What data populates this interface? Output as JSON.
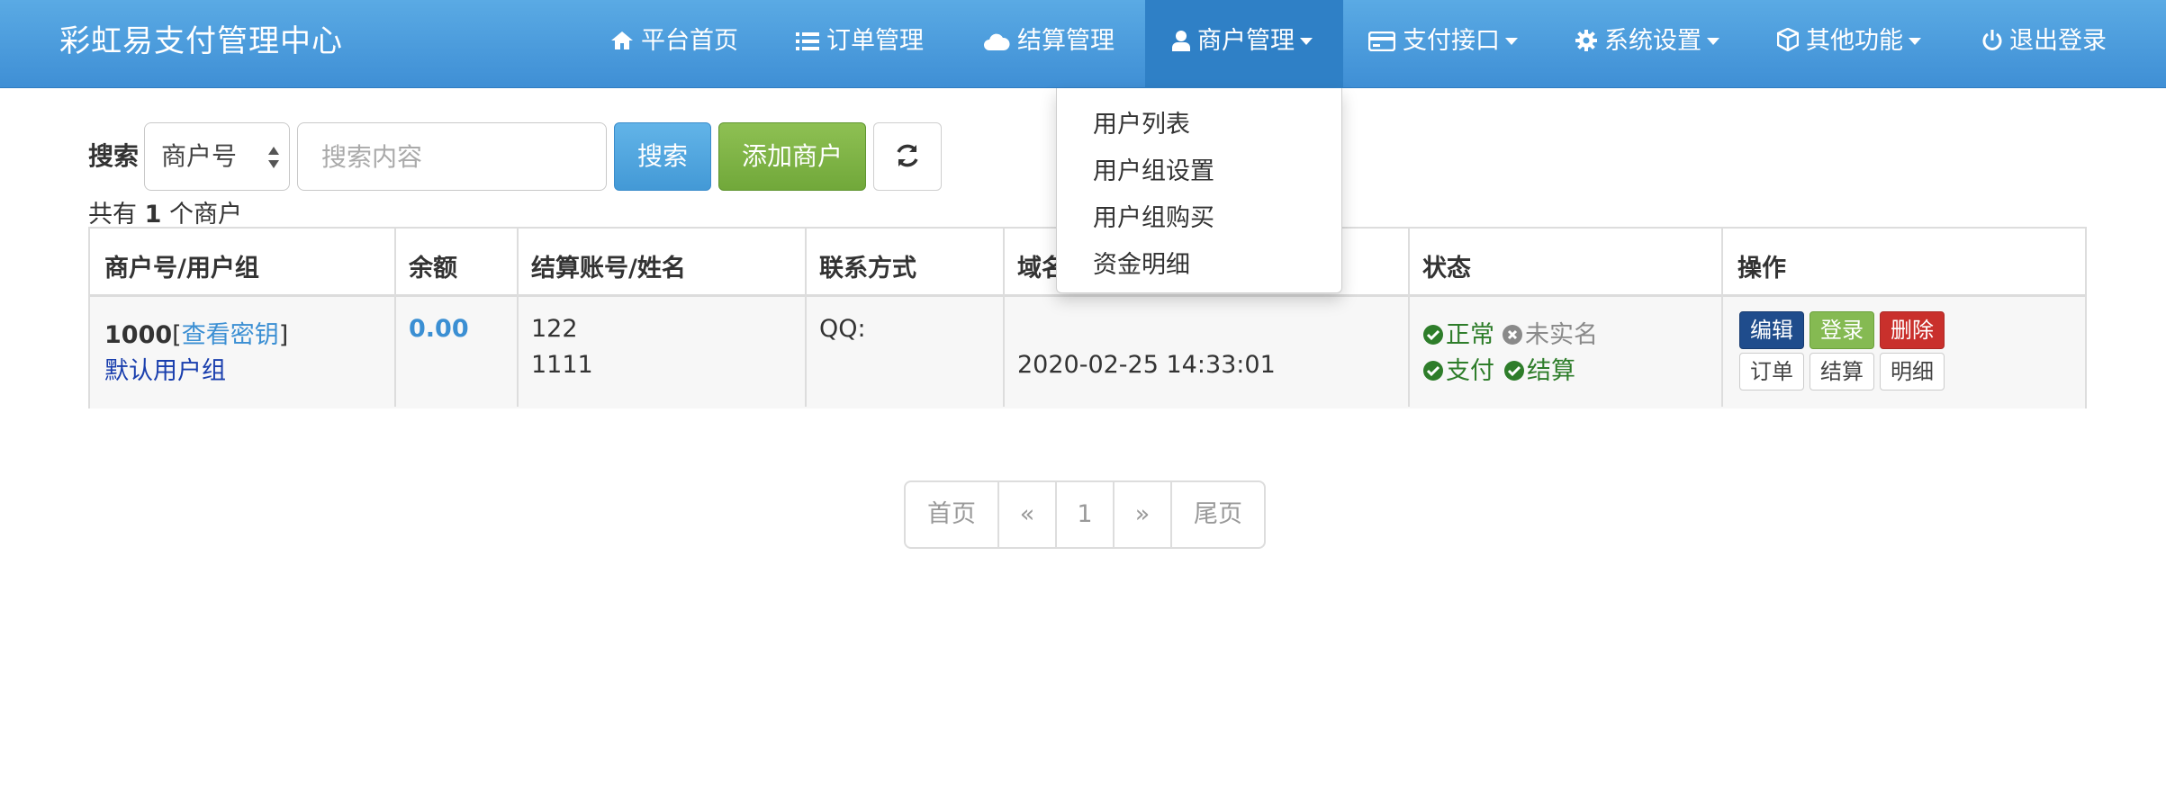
{
  "brand": "彩虹易支付管理中心",
  "nav": {
    "home": "平台首页",
    "orders": "订单管理",
    "settlement": "结算管理",
    "merchants": "商户管理",
    "payment": "支付接口",
    "system": "系统设置",
    "other": "其他功能",
    "logout": "退出登录"
  },
  "dropdown": {
    "items": [
      "用户列表",
      "用户组设置",
      "用户组购买",
      "资金明细"
    ]
  },
  "search": {
    "label": "搜索",
    "select_value": "商户号",
    "placeholder": "搜索内容",
    "search_button": "搜索",
    "add_button": "添加商户"
  },
  "summary": {
    "prefix": "共有 ",
    "count": "1",
    "suffix": " 个商户"
  },
  "table": {
    "headers": [
      "商户号/用户组",
      "余额",
      "结算账号/姓名",
      "联系方式",
      "域名",
      "状态",
      "操作"
    ],
    "row": {
      "uid": "1000",
      "key_open": "[",
      "key_link": "查看密钥",
      "key_close": "]",
      "group": "默认用户组",
      "balance": "0.00",
      "account": "122",
      "name": "1111",
      "contact": "QQ:",
      "date": "2020-02-25 14:33:01",
      "status_normal": "正常",
      "status_unverified": "未实名",
      "status_pay": "支付",
      "status_settle": "结算",
      "ops": {
        "edit": "编辑",
        "login": "登录",
        "delete": "删除",
        "orders": "订单",
        "settle": "结算",
        "detail": "明细"
      }
    }
  },
  "pagination": {
    "first": "首页",
    "prev": "«",
    "page": "1",
    "next": "»",
    "last": "尾页"
  },
  "colors": {
    "navbar": "#4a9ddc",
    "primary": "#4399d6",
    "success": "#71a83a",
    "danger": "#c9302c",
    "status_green": "#2e7d2a"
  }
}
